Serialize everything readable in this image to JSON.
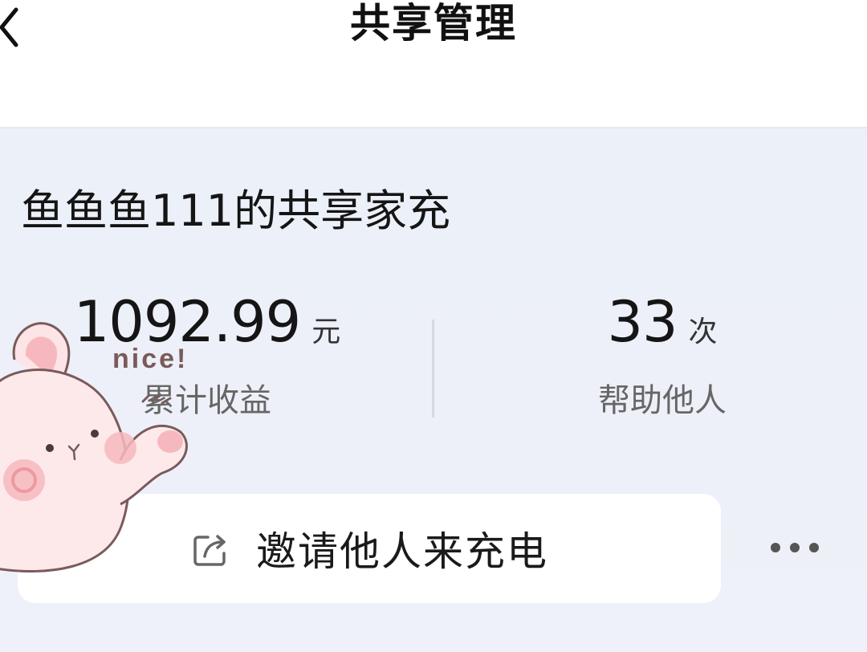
{
  "header": {
    "title": "共享管理",
    "back_icon": "chevron-left-icon"
  },
  "card": {
    "title": "鱼鱼鱼111的共享家充",
    "stats": {
      "earnings": {
        "value": "1092.99",
        "unit": "元",
        "label": "累计收益"
      },
      "helped": {
        "value": "33",
        "unit": "次",
        "label": "帮助他人"
      }
    },
    "invite_button": {
      "label": "邀请他人来充电",
      "icon": "share-icon"
    },
    "more_icon": "more-dots-icon"
  },
  "sticker": {
    "caption": "nice!",
    "icon": "bunny-sticker"
  },
  "colors": {
    "card_background": "#edf0f8",
    "button_background": "#ffffff",
    "primary_text": "#151515",
    "secondary_text": "#666666",
    "sticker_pink": "#f6b8be"
  }
}
